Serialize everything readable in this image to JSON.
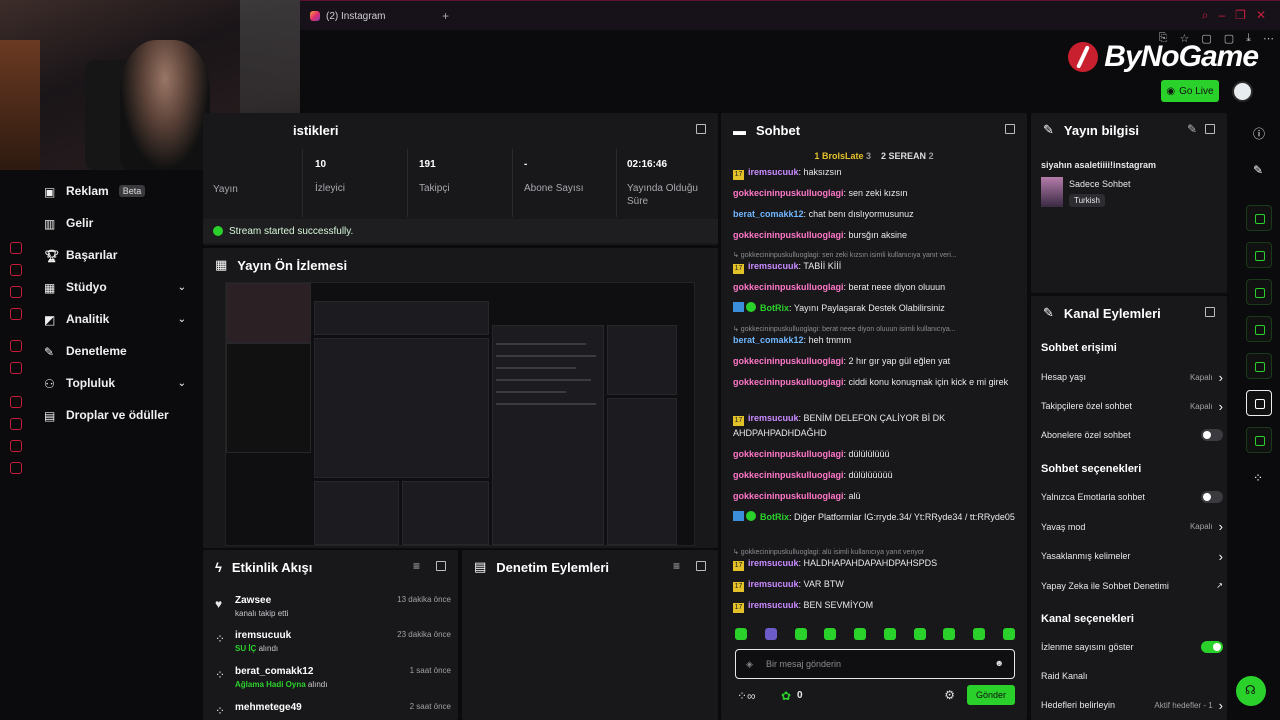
{
  "browser": {
    "tab_label": "(2) Instagram",
    "new_tab": "+"
  },
  "header": {
    "logo_text": "ByNoGame",
    "go_live": "Go Live"
  },
  "sidebar": {
    "items": [
      {
        "label": "Reklam",
        "badge": "Beta"
      },
      {
        "label": "Gelir"
      },
      {
        "label": "Başarılar"
      },
      {
        "label": "Stüdyo",
        "chevron": "⌄"
      },
      {
        "label": "Analitik",
        "chevron": "⌄"
      },
      {
        "label": "Denetleme"
      },
      {
        "label": "Topluluk",
        "chevron": "⌄"
      },
      {
        "label": "Droplar ve ödüller"
      }
    ]
  },
  "stats": {
    "title": "istikleri",
    "cells": [
      {
        "value": "",
        "label": "Yayın"
      },
      {
        "value": "10",
        "label": "İzleyici"
      },
      {
        "value": "191",
        "label": "Takipçi"
      },
      {
        "value": "-",
        "label": "Abone Sayısı"
      },
      {
        "value": "02:16:46",
        "label": "Yayında Olduğu Süre"
      }
    ],
    "status": "Stream started successfully."
  },
  "preview": {
    "title": "Yayın Ön İzlemesi"
  },
  "activity": {
    "title": "Etkinlik Akışı",
    "items": [
      {
        "name": "Zawsee",
        "sub": "kanalı takip etti",
        "time": "13 dakika önce",
        "icon": "heart-icon"
      },
      {
        "name": "iremsucuuk",
        "sub_green": "SU İÇ",
        "sub": " alındı",
        "time": "23 dakika önce",
        "icon": "reward-icon"
      },
      {
        "name": "berat_comakk12",
        "sub_green": "Ağlama Hadi Oyna",
        "sub": " alındı",
        "time": "1 saat önce",
        "icon": "reward-icon"
      },
      {
        "name": "mehmetege49",
        "sub": "",
        "time": "2 saat önce",
        "icon": "reward-icon"
      }
    ]
  },
  "moderation": {
    "title": "Denetim Eylemleri"
  },
  "chat": {
    "title": "Sohbet",
    "top": [
      {
        "rank": "1",
        "name": "BrolsLate",
        "count": "3"
      },
      {
        "rank": "2",
        "name": "SEREAN",
        "count": "2"
      }
    ],
    "messages": [
      {
        "badge": "y",
        "user": "iremsucuuk",
        "color": "#c98bff",
        "text": "haksızsın"
      },
      {
        "user": "gokkecininpuskulluoglagi",
        "color": "#ff77c8",
        "text": "sen zeki kızsın"
      },
      {
        "user": "berat_comakk12",
        "color": "#6fb7ff",
        "text": "chat benı dıslıyormusunuz"
      },
      {
        "user": "gokkecininpuskulluoglagi",
        "color": "#ff77c8",
        "text": "bursğın aksine"
      },
      {
        "sys": true,
        "text": "↳ gokkecininpuskulluoglagi: sen zeki kızsın isimli kullanıcıya yanıt veri..."
      },
      {
        "badge": "y",
        "user": "iremsucuuk",
        "color": "#c98bff",
        "text": "TABİİ Kİİİ"
      },
      {
        "user": "gokkecininpuskulluoglagi",
        "color": "#ff77c8",
        "text": "berat neee diyon oluuun"
      },
      {
        "badge": "bot",
        "user": "BotRix",
        "color": "#2bd12b",
        "text": "Yayını Paylaşarak Destek Olabilirsiniz"
      },
      {
        "sys": true,
        "text": "↳ gokkecininpuskulluoglagi: berat neee diyon oluuun isimli kullanıcıya..."
      },
      {
        "user": "berat_comakk12",
        "color": "#6fb7ff",
        "text": "heh tmmm"
      },
      {
        "user": "gokkecininpuskulluoglagi",
        "color": "#ff77c8",
        "text": "2 hır gır yap gül eğlen yat"
      },
      {
        "user": "gokkecininpuskulluoglagi",
        "color": "#ff77c8",
        "text": "ciddi konu konuşmak için kick e mi girek"
      },
      {
        "badge": "y",
        "user": "iremsucuuk",
        "color": "#c98bff",
        "text": "BENİM DELEFON ÇALİYOR Bİ DK AHDPAHPADHDAĞHD"
      },
      {
        "user": "gokkecininpuskulluoglagi",
        "color": "#ff77c8",
        "text": "dülülülüüü"
      },
      {
        "user": "gokkecininpuskulluoglagi",
        "color": "#ff77c8",
        "text": "dülülüüüüü"
      },
      {
        "user": "gokkecininpuskulluoglagi",
        "color": "#ff77c8",
        "text": "alü"
      },
      {
        "badge": "bot",
        "user": "BotRix",
        "color": "#2bd12b",
        "text": "Diğer Platformlar IG:rryde.34/ Yt:RRyde34 / tt:RRyde05"
      },
      {
        "sys": true,
        "text": "↳ gokkecininpuskulluoglagi: alü isimli kullanıcıya yanıt veriyor"
      },
      {
        "badge": "y",
        "user": "iremsucuuk",
        "color": "#c98bff",
        "text": "HALDHAPAHDAPAHDPAHSPDS"
      },
      {
        "badge": "y",
        "user": "iremsucuuk",
        "color": "#c98bff",
        "text": "VAR BTW"
      },
      {
        "badge": "y",
        "user": "iremsucuuk",
        "color": "#c98bff",
        "text": "BEN SEVMİYOM"
      }
    ],
    "input_placeholder": "Bir mesaj gönderin",
    "points": "0",
    "send": "Gönder"
  },
  "stream_info": {
    "title": "Yayın bilgisi",
    "stream_title": "siyahın asaletiiii!instagram",
    "category": "Sadece Sohbet",
    "language": "Turkish"
  },
  "channel_actions": {
    "title": "Kanal Eylemleri",
    "chat_access": "Sohbet erişimi",
    "access_items": [
      {
        "label": "Hesap yaşı",
        "state": "Kapalı",
        "type": "chev"
      },
      {
        "label": "Takipçilere özel sohbet",
        "state": "Kapalı",
        "type": "chev"
      },
      {
        "label": "Abonelere özel sohbet",
        "state": "",
        "type": "toggle-off"
      }
    ],
    "chat_options": "Sohbet seçenekleri",
    "option_items": [
      {
        "label": "Yalnızca Emotlarla sohbet",
        "state": "",
        "type": "toggle-off"
      },
      {
        "label": "Yavaş mod",
        "state": "Kapalı",
        "type": "chev"
      },
      {
        "label": "Yasaklanmış kelimeler",
        "state": "",
        "type": "chev"
      },
      {
        "label": "Yapay Zeka ile Sohbet Denetimi",
        "state": "",
        "type": "ext"
      }
    ],
    "channel_options": "Kanal seçenekleri",
    "channel_items": [
      {
        "label": "İzlenme sayısını göster",
        "state": "",
        "type": "toggle-on"
      },
      {
        "label": "Raid Kanalı",
        "state": "",
        "type": "none"
      },
      {
        "label": "Hedefleri belirleyin",
        "state": "Aktif hedefler - 1",
        "type": "chev"
      }
    ]
  },
  "colors": {
    "accent": "#2bd12b",
    "brand": "#c8202e",
    "panel": "#18181b"
  }
}
